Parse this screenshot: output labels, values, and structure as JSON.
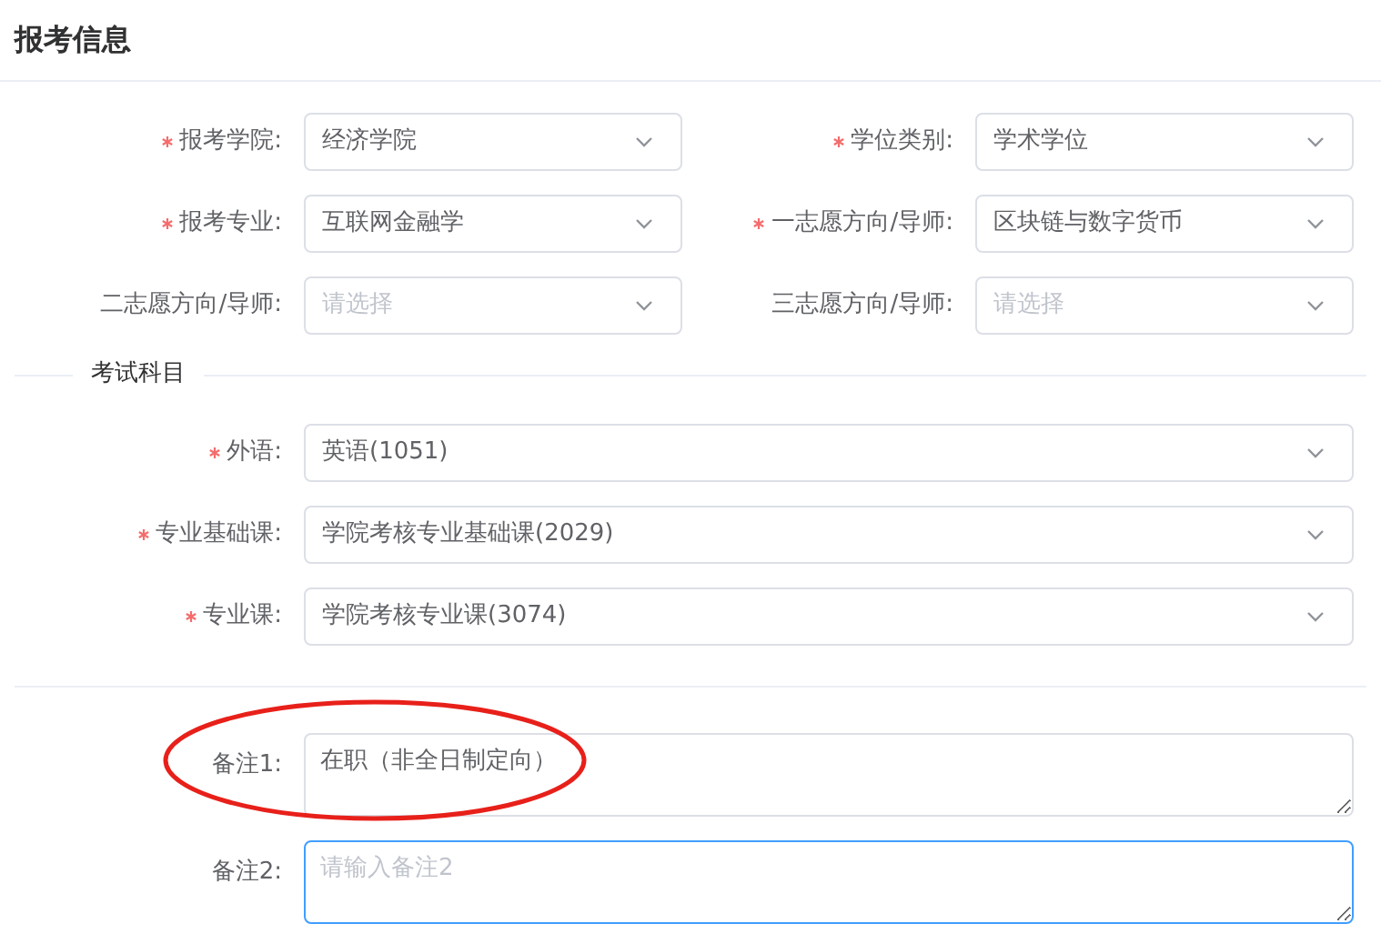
{
  "title": "报考信息",
  "choices": [
    {
      "label": "报考学院:",
      "required": true,
      "value": "经济学院"
    },
    {
      "label": "学位类别:",
      "required": true,
      "value": "学术学位"
    },
    {
      "label": "报考专业:",
      "required": true,
      "value": "互联网金融学"
    },
    {
      "label": "一志愿方向/导师:",
      "required": true,
      "value": "区块链与数字货币"
    },
    {
      "label": "二志愿方向/导师:",
      "required": false,
      "placeholder": "请选择"
    },
    {
      "label": "三志愿方向/导师:",
      "required": false,
      "placeholder": "请选择"
    }
  ],
  "exam_section": {
    "title": "考试科目",
    "subjects": [
      {
        "label": "外语:",
        "required": true,
        "value": "英语(1051)"
      },
      {
        "label": "专业基础课:",
        "required": true,
        "value": "学院考核专业基础课(2029)"
      },
      {
        "label": "专业课:",
        "required": true,
        "value": "学院考核专业课(3074)"
      }
    ]
  },
  "remarks": [
    {
      "label": "备注1:",
      "value": "在职（非全日制定向）",
      "focused": false,
      "circled": true
    },
    {
      "label": "备注2:",
      "placeholder": "请输入备注2",
      "focused": true,
      "circled": false
    }
  ]
}
